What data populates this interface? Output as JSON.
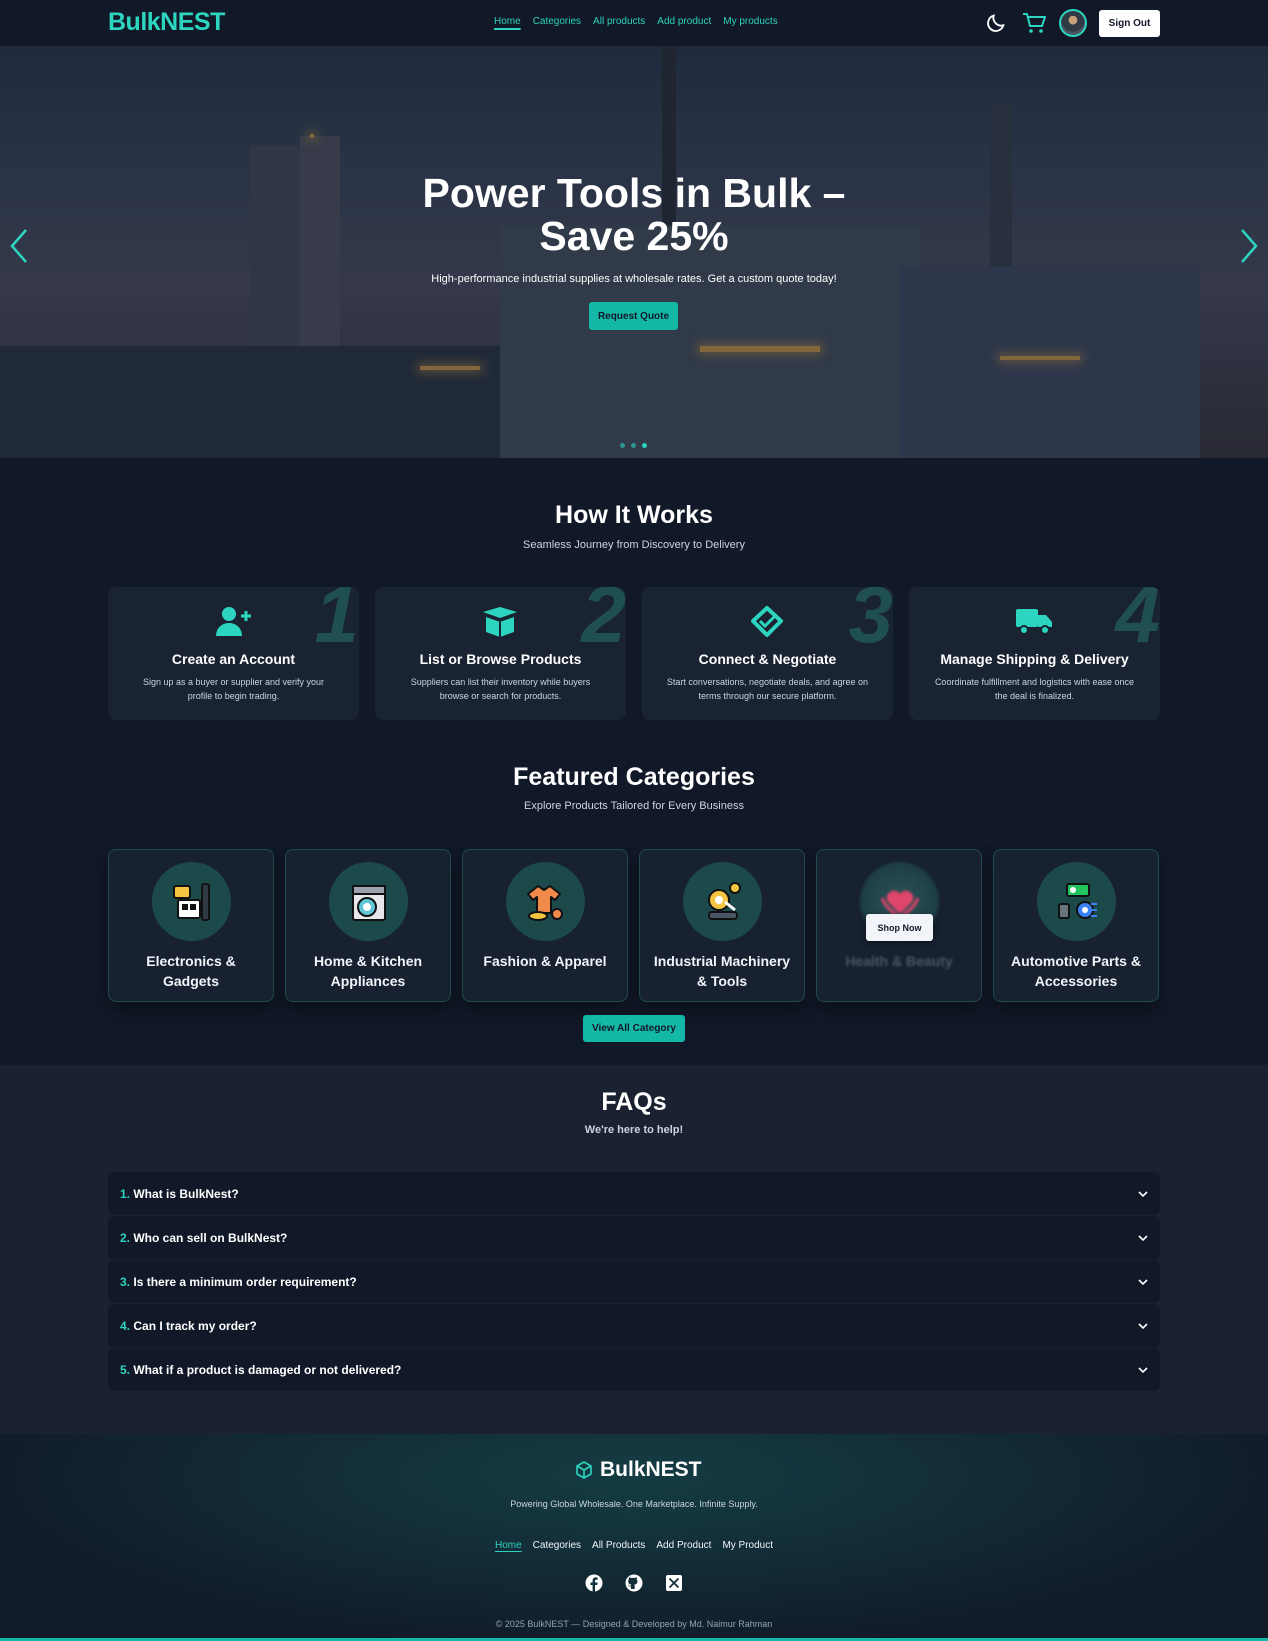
{
  "nav": {
    "logo": "BulkNEST",
    "links": [
      "Home",
      "Categories",
      "All products",
      "Add product",
      "My products"
    ],
    "signout": "Sign Out"
  },
  "hero": {
    "title_line1": "Power Tools in Bulk –",
    "title_line2": "Save 25%",
    "subtitle": "High-performance industrial supplies at wholesale rates. Get a custom quote today!",
    "cta": "Request Quote",
    "active_slide": 3,
    "total_slides": 3
  },
  "how": {
    "title": "How It Works",
    "subtitle": "Seamless Journey from Discovery to Delivery",
    "steps": [
      {
        "num": "1",
        "title": "Create an Account",
        "desc": "Sign up as a buyer or supplier and verify your profile to begin trading.",
        "icon": "user-plus-icon"
      },
      {
        "num": "2",
        "title": "List or Browse Products",
        "desc": "Suppliers can list their inventory while buyers browse or search for products.",
        "icon": "box-open-icon"
      },
      {
        "num": "3",
        "title": "Connect & Negotiate",
        "desc": "Start conversations, negotiate deals, and agree on terms through our secure platform.",
        "icon": "handshake-icon"
      },
      {
        "num": "4",
        "title": "Manage Shipping & Delivery",
        "desc": "Coordinate fulfillment and logistics with ease once the deal is finalized.",
        "icon": "truck-icon"
      }
    ]
  },
  "categories": {
    "title": "Featured Categories",
    "subtitle": "Explore Products Tailored for Every Business",
    "items": [
      {
        "name": "Electronics & Gadgets",
        "icon": "electronics-icon"
      },
      {
        "name": "Home & Kitchen Appliances",
        "icon": "appliances-icon"
      },
      {
        "name": "Fashion & Apparel",
        "icon": "apparel-icon"
      },
      {
        "name": "Industrial Machinery & Tools",
        "icon": "machinery-icon"
      },
      {
        "name": "Health & Beauty",
        "icon": "health-icon"
      },
      {
        "name": "Automotive Parts & Accessories",
        "icon": "automotive-icon"
      }
    ],
    "shop_now": "Shop Now",
    "view_all": "View All Category"
  },
  "faq": {
    "title": "FAQs",
    "subtitle": "We're here to help!",
    "items": [
      {
        "n": "1.",
        "q": "What is BulkNest?"
      },
      {
        "n": "2.",
        "q": "Who can sell on BulkNest?"
      },
      {
        "n": "3.",
        "q": "Is there a minimum order requirement?"
      },
      {
        "n": "4.",
        "q": "Can I track my order?"
      },
      {
        "n": "5.",
        "q": "What if a product is damaged or not delivered?"
      }
    ]
  },
  "footer": {
    "logo": "BulkNEST",
    "tagline": "Powering Global Wholesale. One Marketplace. Infinite Supply.",
    "links": [
      "Home",
      "Categories",
      "All Products",
      "Add Product",
      "My Product"
    ],
    "copyright": "© 2025 BulkNEST — Designed & Developed by Md. Naimur Rahman"
  },
  "colors": {
    "accent": "#2dd4bf",
    "button": "#14b8a6",
    "background": "#111827",
    "card": "#1a2331"
  }
}
